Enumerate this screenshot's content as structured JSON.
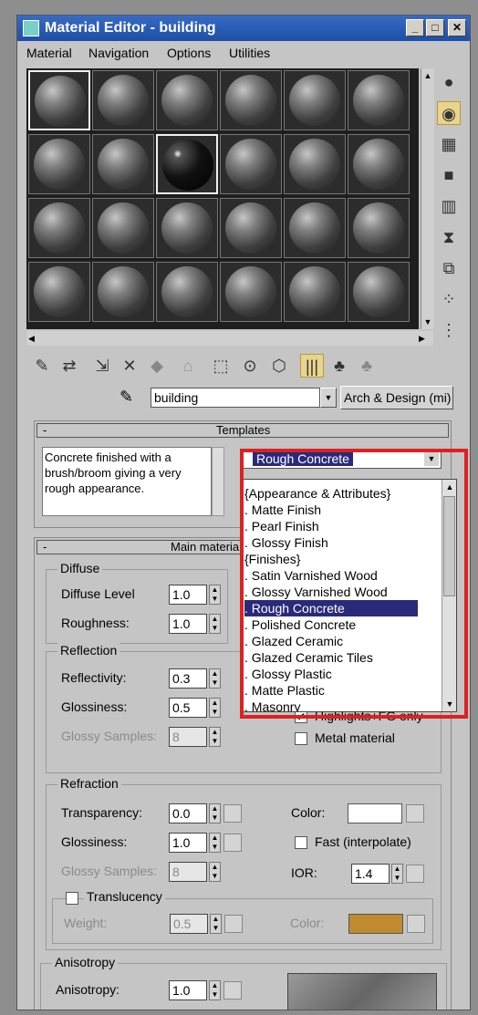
{
  "window": {
    "title": "Material Editor - building"
  },
  "menu": [
    "Material",
    "Navigation",
    "Options",
    "Utilities"
  ],
  "material": {
    "name": "building",
    "type": "Arch & Design (mi)"
  },
  "templates": {
    "header": "Templates",
    "description": "Concrete finished with a brush/broom giving a very rough appearance.",
    "selected": "Rough Concrete",
    "list": [
      "{Appearance & Attributes}",
      "Matte Finish",
      "Pearl Finish",
      "Glossy Finish",
      "{Finishes}",
      "Satin Varnished Wood",
      "Glossy Varnished Wood",
      "Rough Concrete",
      "Polished Concrete",
      "Glazed Ceramic",
      "Glazed Ceramic Tiles",
      "Glossy Plastic",
      "Matte Plastic",
      "Masonry"
    ]
  },
  "main": {
    "header": "Main materia"
  },
  "diffuse": {
    "label": "Diffuse",
    "level_label": "Diffuse Level",
    "level": "1.0",
    "rough_label": "Roughness:",
    "rough": "1.0"
  },
  "reflection": {
    "label": "Reflection",
    "reflectivity_label": "Reflectivity:",
    "reflectivity": "0.3",
    "glossiness_label": "Glossiness:",
    "glossiness": "0.5",
    "samples_label": "Glossy Samples:",
    "samples": "8",
    "highlights_label": "Highlights+FG only",
    "metal_label": "Metal material"
  },
  "refraction": {
    "label": "Refraction",
    "transparency_label": "Transparency:",
    "transparency": "0.0",
    "glossiness_label": "Glossiness:",
    "glossiness": "1.0",
    "samples_label": "Glossy Samples:",
    "samples": "8",
    "color_label": "Color:",
    "fast_label": "Fast (interpolate)",
    "ior_label": "IOR:",
    "ior": "1.4",
    "translucency_label": "Translucency",
    "weight_label": "Weight:",
    "weight": "0.5",
    "trans_color_label": "Color:"
  },
  "anisotropy": {
    "label": "Anisotropy",
    "anisotropy_label": "Anisotropy:",
    "anisotropy": "1.0"
  },
  "colors": {
    "refraction_color": "#ffffff",
    "translucency_color": "#c08a30",
    "highlight": "#2a2a7a",
    "callout": "#e02020"
  }
}
